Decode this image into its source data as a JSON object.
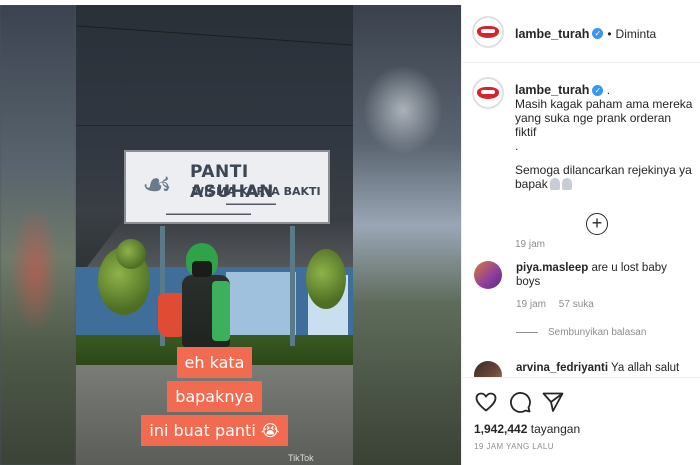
{
  "header": {
    "username": "lambe_turah",
    "separator": "•",
    "follow_status": "Diminta"
  },
  "video": {
    "sign_title": "PANTI ASUHAN",
    "sign_subtitle": "WISMA KARYA BAKTI",
    "caption_lines": [
      "eh kata",
      "bapaknya",
      "ini buat panti"
    ],
    "watermark": "TikTok"
  },
  "post_caption": {
    "username": "lambe_turah",
    "trailing": ".",
    "line1": "Masih kagak paham ama mereka yang suka nge prank orderan fiktif",
    "line2": ".",
    "line3": "Semoga dilancarkan rejekinya ya bapak",
    "time": "19 jam"
  },
  "comments": [
    {
      "username": "piya.masleep",
      "text": "are u lost baby boys",
      "time": "19 jam",
      "likes": "57 suka",
      "hide_replies": "Sembunyikan balasan"
    },
    {
      "username": "arvina_fedriyanti",
      "text": "Ya allah salut"
    }
  ],
  "actions": {
    "like_icon": "heart-icon",
    "comment_icon": "comment-icon",
    "share_icon": "share-icon",
    "view_count": "1,942,442",
    "view_label": "tayangan",
    "date": "19 JAM YANG LALU"
  },
  "colors": {
    "caption_bg": "#f26a50",
    "verified": "#3897f0",
    "muted": "#8e8e8e",
    "text": "#262626"
  }
}
